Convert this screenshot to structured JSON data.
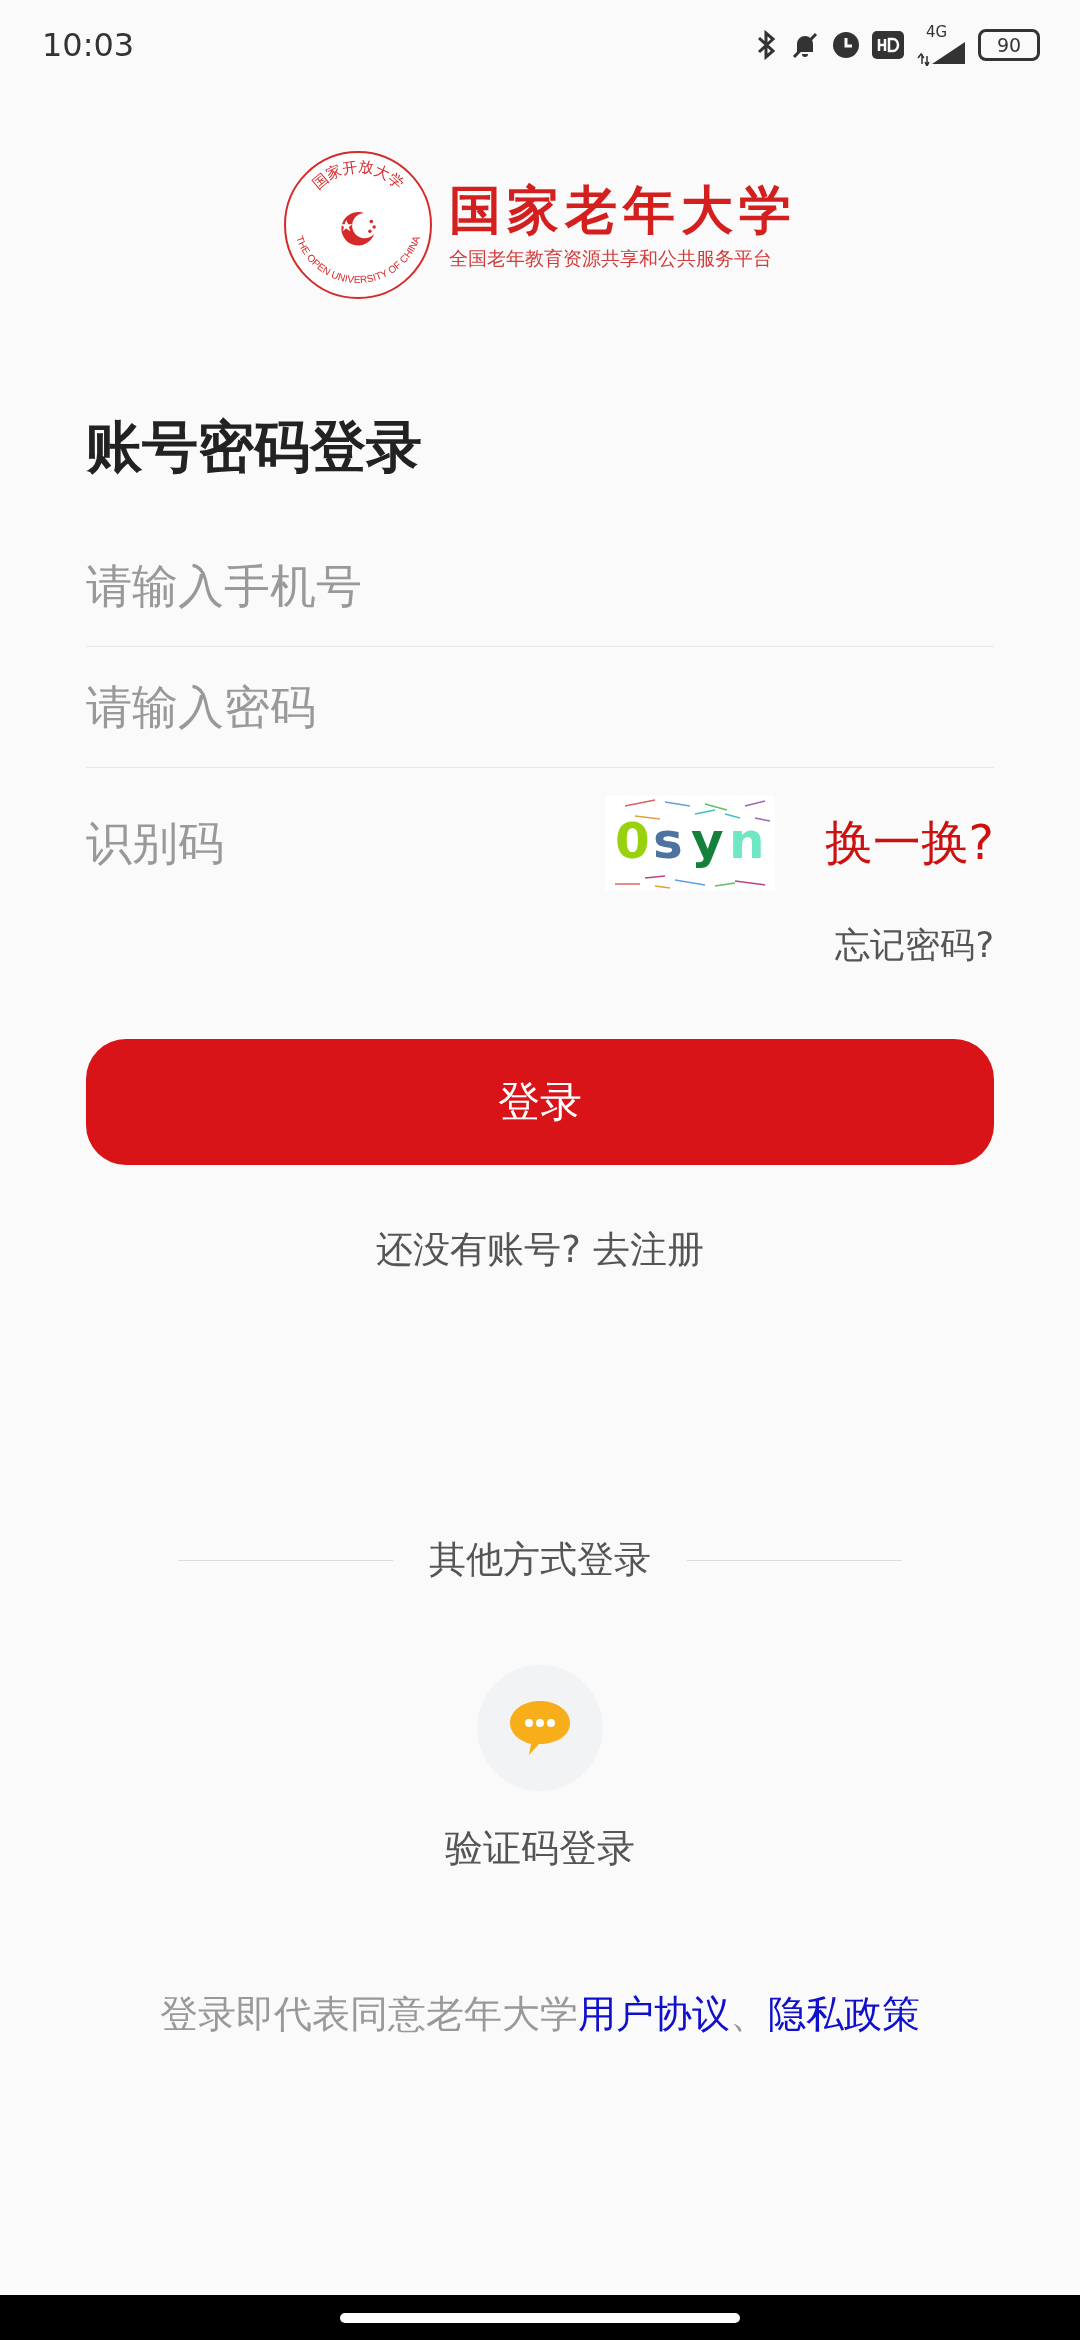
{
  "status_bar": {
    "time": "10:03",
    "network": "4G",
    "battery": "90"
  },
  "logo": {
    "seal_text": "国家开放大学",
    "seal_english": "THE OPEN UNIVERSITY OF CHINA",
    "title": "国家老年大学",
    "subtitle": "全国老年教育资源共享和公共服务平台"
  },
  "heading": "账号密码登录",
  "fields": [
    {
      "placeholder": "请输入手机号"
    },
    {
      "placeholder": "请输入密码"
    }
  ],
  "captcha": {
    "placeholder": "识别码",
    "code": [
      {
        "char": "0",
        "color": "#9ad10f"
      },
      {
        "char": "s",
        "color": "#4f73a0"
      },
      {
        "char": "y",
        "color": "#15803a"
      },
      {
        "char": "n",
        "color": "#6ee8c4"
      }
    ],
    "refresh": "换一换?"
  },
  "forgot_password": "忘记密码?",
  "login_button": "登录",
  "register": "还没有账号? 去注册",
  "other_methods": {
    "label": "其他方式登录",
    "items": [
      {
        "label": "验证码登录"
      }
    ]
  },
  "agreement": {
    "text": "登录即代表同意老年大学",
    "links": [
      "用户协议",
      "隐私政策"
    ],
    "separator": "、"
  }
}
